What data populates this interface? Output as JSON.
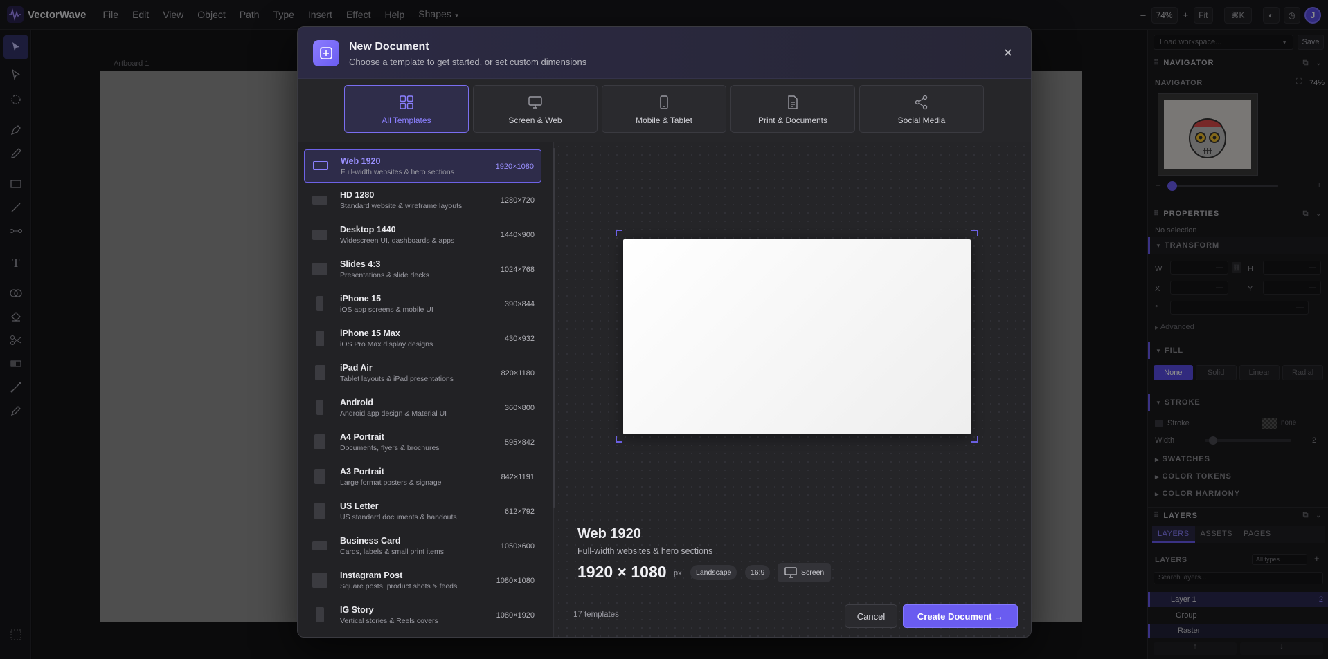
{
  "app": {
    "name": "VectorWave",
    "accent": "#6a5cf0"
  },
  "menu": [
    "File",
    "Edit",
    "View",
    "Object",
    "Path",
    "Type",
    "Insert",
    "Effect",
    "Help",
    "Shapes"
  ],
  "topbar": {
    "zoom": "74%",
    "zoom_minus": "–",
    "zoom_plus": "+",
    "fit": "Fit",
    "shortcut": "⌘K",
    "avatar": "J"
  },
  "canvas": {
    "artboard_label": "Artboard 1"
  },
  "right_panel": {
    "workspace_placeholder": "Load workspace...",
    "save": "Save",
    "navigator_header": "NAVIGATOR",
    "navigator_label": "NAVIGATOR",
    "navigator_zoom": "74%",
    "properties_header": "PROPERTIES",
    "no_selection": "No selection",
    "transform": "TRANSFORM",
    "w": "W",
    "h": "H",
    "x": "X",
    "y": "Y",
    "dash": "—",
    "advanced": "Advanced",
    "fill": "FILL",
    "fill_modes": [
      "None",
      "Solid",
      "Linear",
      "Radial"
    ],
    "stroke": "STROKE",
    "stroke_label": "Stroke",
    "stroke_none": "none",
    "width_label": "Width",
    "width_value": "2",
    "swatches": "SWATCHES",
    "color_tokens": "COLOR TOKENS",
    "color_harmony": "COLOR HARMONY",
    "layers_header": "LAYERS",
    "layer_tabs": [
      "LAYERS",
      "ASSETS",
      "PAGES"
    ],
    "layers_label": "LAYERS",
    "all_types": "All types",
    "search_placeholder": "Search layers...",
    "layers": [
      {
        "name": "Layer 1",
        "count": "2"
      },
      {
        "name": "Group"
      },
      {
        "name": "Raster"
      }
    ]
  },
  "modal": {
    "title": "New Document",
    "subtitle": "Choose a template to get started, or set custom dimensions",
    "tabs": [
      {
        "label": "All Templates",
        "icon": "grid-icon"
      },
      {
        "label": "Screen & Web",
        "icon": "monitor-icon"
      },
      {
        "label": "Mobile & Tablet",
        "icon": "phone-icon"
      },
      {
        "label": "Print & Documents",
        "icon": "document-icon"
      },
      {
        "label": "Social Media",
        "icon": "share-icon"
      }
    ],
    "templates": [
      {
        "name": "Web 1920",
        "desc": "Full-width websites & hero sections",
        "size": "1920×1080"
      },
      {
        "name": "HD 1280",
        "desc": "Standard website & wireframe layouts",
        "size": "1280×720"
      },
      {
        "name": "Desktop 1440",
        "desc": "Widescreen UI, dashboards & apps",
        "size": "1440×900"
      },
      {
        "name": "Slides 4:3",
        "desc": "Presentations & slide decks",
        "size": "1024×768"
      },
      {
        "name": "iPhone 15",
        "desc": "iOS app screens & mobile UI",
        "size": "390×844"
      },
      {
        "name": "iPhone 15 Max",
        "desc": "iOS Pro Max display designs",
        "size": "430×932"
      },
      {
        "name": "iPad Air",
        "desc": "Tablet layouts & iPad presentations",
        "size": "820×1180"
      },
      {
        "name": "Android",
        "desc": "Android app design & Material UI",
        "size": "360×800"
      },
      {
        "name": "A4 Portrait",
        "desc": "Documents, flyers & brochures",
        "size": "595×842"
      },
      {
        "name": "A3 Portrait",
        "desc": "Large format posters & signage",
        "size": "842×1191"
      },
      {
        "name": "US Letter",
        "desc": "US standard documents & handouts",
        "size": "612×792"
      },
      {
        "name": "Business Card",
        "desc": "Cards, labels & small print items",
        "size": "1050×600"
      },
      {
        "name": "Instagram Post",
        "desc": "Square posts, product shots & feeds",
        "size": "1080×1080"
      },
      {
        "name": "IG Story",
        "desc": "Vertical stories & Reels covers",
        "size": "1080×1920"
      }
    ],
    "preview": {
      "title": "Web 1920",
      "desc": "Full-width websites & hero sections",
      "dims": "1920 × 1080",
      "unit": "px",
      "orientation": "Landscape",
      "ratio": "16:9",
      "category": "Screen"
    },
    "count": "17 templates",
    "cancel": "Cancel",
    "create": "Create Document →"
  }
}
